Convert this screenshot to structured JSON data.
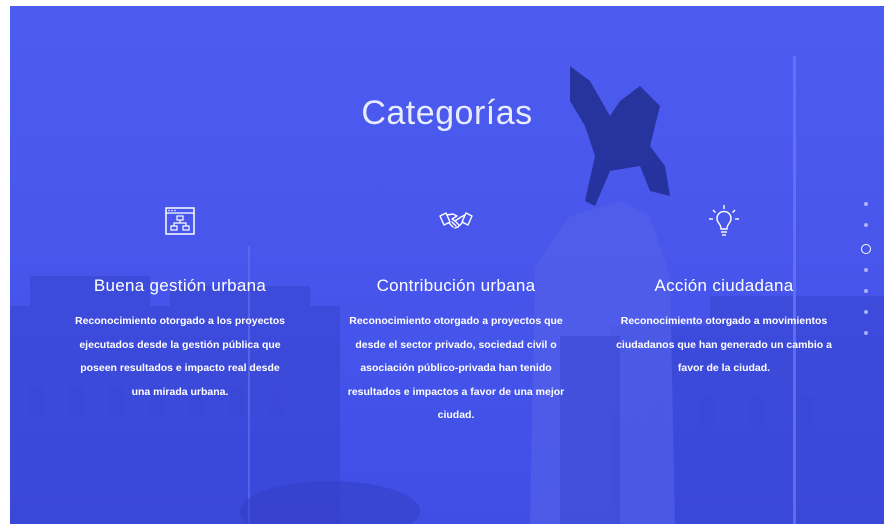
{
  "section": {
    "title": "Categorías"
  },
  "categories": [
    {
      "icon": "org-chart-window-icon",
      "title": "Buena gestión urbana",
      "description": "Reconocimiento otorgado a los proyectos ejecutados desde la gestión pública que poseen resultados e impacto real desde una mirada urbana."
    },
    {
      "icon": "handshake-icon",
      "title": "Contribución urbana",
      "description": "Reconocimiento otorgado a proyectos que desde el sector privado, sociedad civil o asociación público-privada han tenido resultados e impactos a favor de una mejor ciudad."
    },
    {
      "icon": "lightbulb-icon",
      "title": "Acción ciudadana",
      "description": "Reconocimiento otorgado a movimientos ciudadanos que han generado un cambio a favor de la ciudad."
    }
  ],
  "pagination": {
    "total": 7,
    "active_index": 2
  },
  "colors": {
    "overlay": "#4856ec",
    "text": "#ffffff"
  }
}
